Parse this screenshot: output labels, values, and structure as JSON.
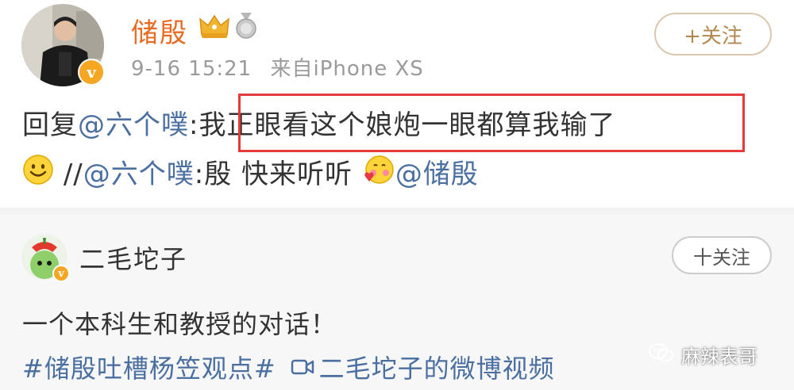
{
  "post1": {
    "username": "储殷",
    "time": "9-16 15:21",
    "source": "来自iPhone XS",
    "follow_label": "+关注",
    "line1": {
      "prefix": "回复",
      "mention": "@六个噗",
      "colon": ":",
      "quote": "我正眼看这个娘炮一眼都算我输了"
    },
    "line2": {
      "slashes": "//",
      "mention1": "@六个噗",
      "text": ":殷 快来听听",
      "mention2": "@储殷"
    },
    "colors": {
      "username": "#e86b23",
      "mention": "#4a6fa0",
      "highlight_box": "#e63a3a"
    }
  },
  "post2": {
    "username": "二毛坨子",
    "follow_label": "十关注",
    "text": "一个本科生和教授的对话！",
    "hashtag": "#储殷吐槽杨笠观点#",
    "video_link": "二毛坨子的微博视频"
  },
  "watermark": {
    "text": "麻辣表哥"
  },
  "icons": [
    "crown-level-icon",
    "medal-icon",
    "verified-v-icon",
    "smile-emoji-icon",
    "blush-emoji-icon",
    "video-camera-icon",
    "wechat-icon"
  ]
}
